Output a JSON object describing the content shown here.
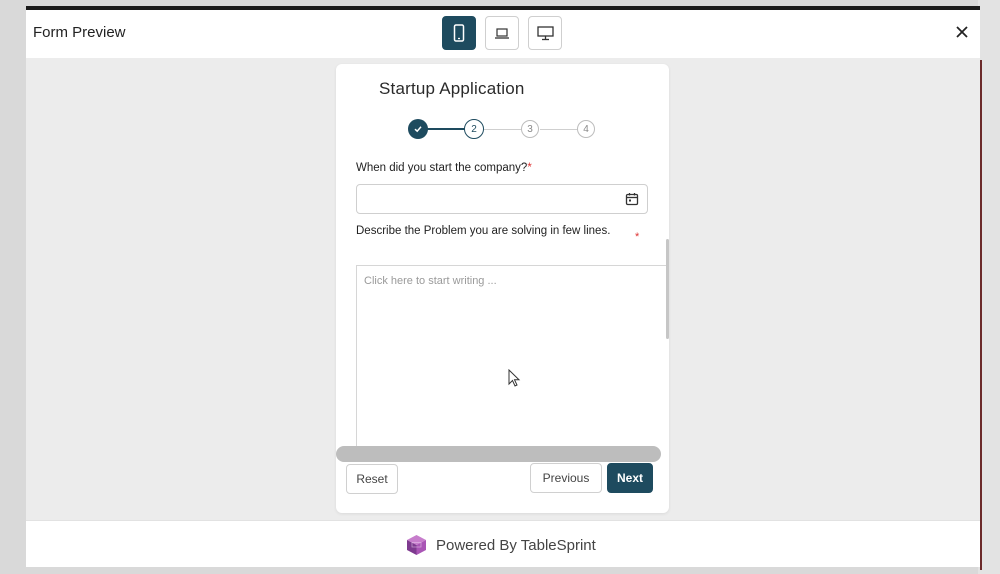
{
  "modal": {
    "title": "Form Preview"
  },
  "devices": [
    {
      "name": "mobile",
      "icon": "smartphone-icon",
      "active": true
    },
    {
      "name": "tablet",
      "icon": "laptop-icon",
      "active": false
    },
    {
      "name": "desktop",
      "icon": "monitor-icon",
      "active": false
    }
  ],
  "form": {
    "title": "Startup Application",
    "steps": [
      {
        "label": "✓",
        "state": "done"
      },
      {
        "label": "2",
        "state": "current"
      },
      {
        "label": "3",
        "state": "todo"
      },
      {
        "label": "4",
        "state": "todo"
      }
    ],
    "fields": [
      {
        "label": "When did you start the company?",
        "required": "*",
        "type": "date",
        "value": ""
      },
      {
        "label": "Describe the Problem you are solving in few lines.",
        "required": "*",
        "type": "textarea",
        "placeholder": "Click here to start writing ...",
        "value": ""
      }
    ],
    "buttons": {
      "reset": "Reset",
      "previous": "Previous",
      "next": "Next"
    }
  },
  "footer": {
    "text": "Powered By TableSprint"
  },
  "colors": {
    "accent": "#1e4b5f",
    "required": "#dd3333"
  }
}
